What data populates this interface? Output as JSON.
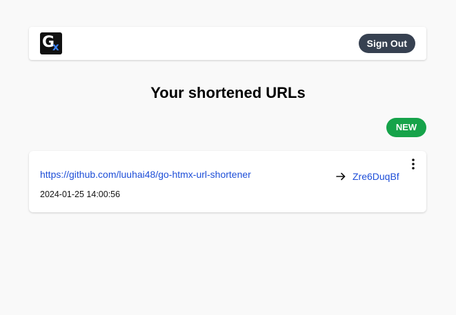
{
  "header": {
    "logo_letter": "G",
    "logo_accent": "x",
    "sign_out_label": "Sign Out"
  },
  "page_title": "Your shortened URLs",
  "new_button_label": "NEW",
  "urls": [
    {
      "original_url": "https://github.com/luuhai48/go-htmx-url-shortener",
      "created_at": "2024-01-25 14:00:56",
      "short_code": "Zre6DuqBf",
      "arrow_icon": "arrow-right-icon",
      "menu_icon": "more-vertical-icon"
    }
  ],
  "colors": {
    "background": "#f9f9f9",
    "sign_out_bg": "#374151",
    "new_bg": "#16a34a",
    "link": "#1d4ed8",
    "logo_accent": "#3b82f6"
  }
}
